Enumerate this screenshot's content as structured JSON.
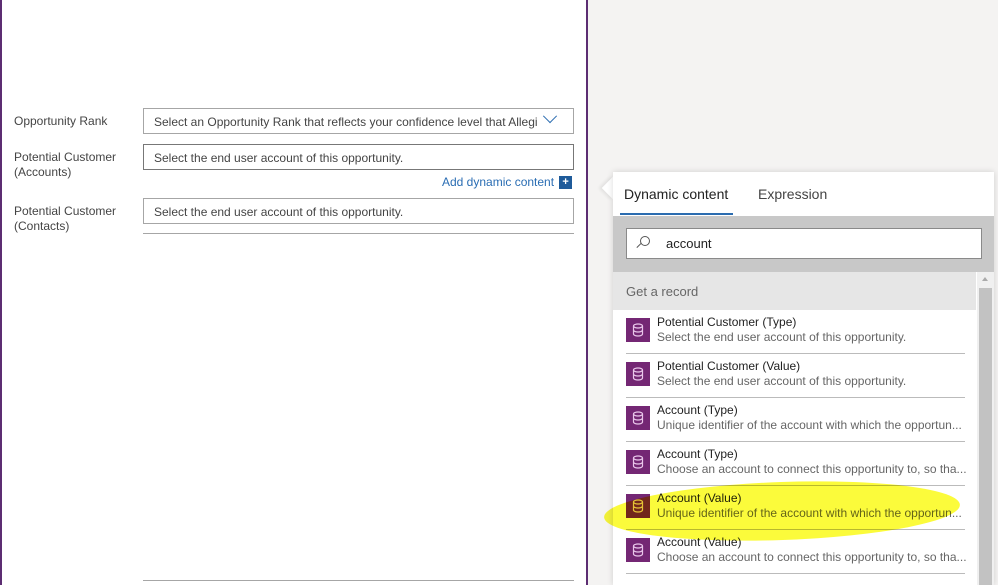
{
  "form": {
    "fields": [
      {
        "label": "Opportunity Rank",
        "placeholder": "Select an Opportunity Rank that reflects your confidence level that Allegi"
      },
      {
        "label": "Potential Customer (Accounts)",
        "placeholder": "Select the end user account of this opportunity."
      },
      {
        "label": "Potential Customer (Contacts)",
        "placeholder": "Select the end user account of this opportunity."
      }
    ],
    "add_dynamic_content": "Add dynamic content",
    "add_icon": "+"
  },
  "panel": {
    "tabs": [
      {
        "label": "Dynamic content",
        "active": true
      },
      {
        "label": "Expression",
        "active": false
      }
    ],
    "search_value": "account",
    "group_header": "Get a record",
    "items": [
      {
        "title": "Potential Customer (Type)",
        "desc": "Select the end user account of this opportunity."
      },
      {
        "title": "Potential Customer (Value)",
        "desc": "Select the end user account of this opportunity."
      },
      {
        "title": "Account (Type)",
        "desc": "Unique identifier of the account with which the opportun..."
      },
      {
        "title": "Account (Type)",
        "desc": "Choose an account to connect this opportunity to, so tha..."
      },
      {
        "title": "Account (Value)",
        "desc": "Unique identifier of the account with which the opportun...",
        "highlighted": true
      },
      {
        "title": "Account (Value)",
        "desc": "Choose an account to connect this opportunity to, so tha..."
      }
    ],
    "icon": "database-icon",
    "accent": "#2b6cb0",
    "icon_color": "#742774",
    "highlight_color": "#fbfb2a"
  }
}
